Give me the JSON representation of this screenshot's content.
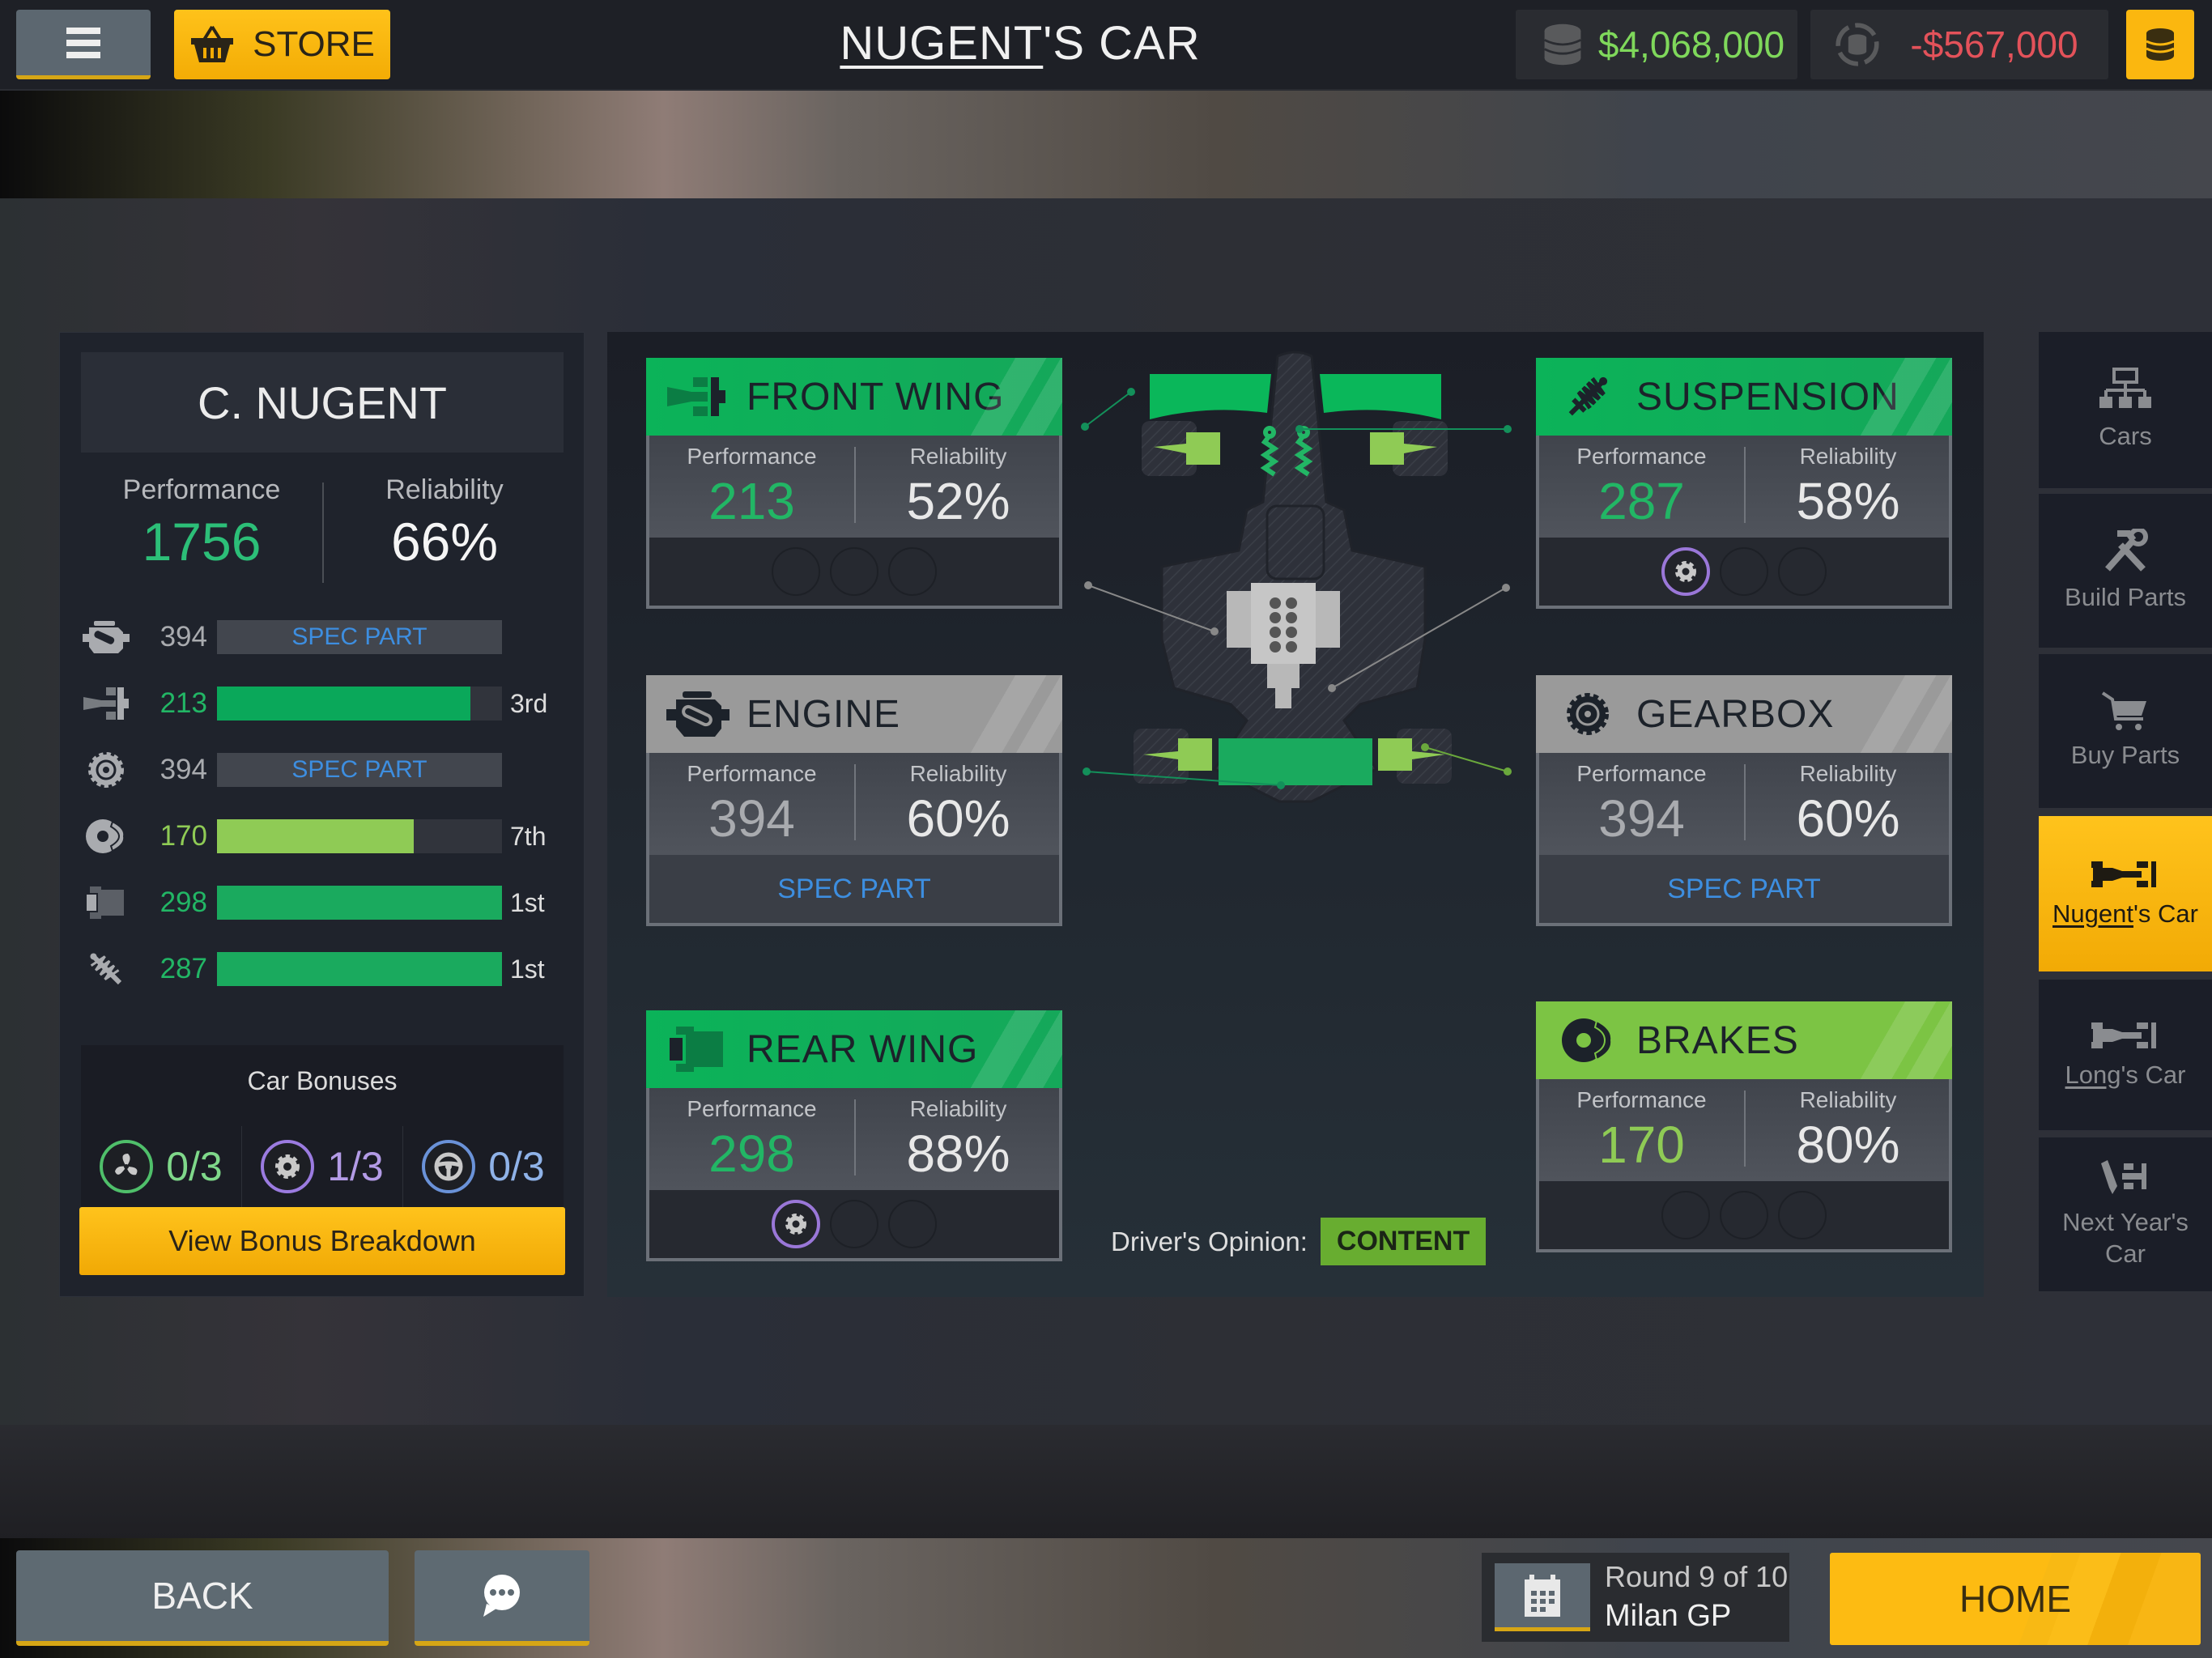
{
  "header": {
    "menu_icon": "hamburger-icon",
    "store_label": "STORE",
    "title_underlined": "NUGENT",
    "title_rest": "'S CAR",
    "balance": "$4,068,000",
    "balance_change": "-$567,000"
  },
  "driver": {
    "name": "C. NUGENT",
    "performance_label": "Performance",
    "performance": "1756",
    "reliability_label": "Reliability",
    "reliability": "66%",
    "parts": [
      {
        "part": "engine",
        "icon": "engine-icon",
        "value": "394",
        "spec": "SPEC PART",
        "rank": ""
      },
      {
        "part": "front-wing",
        "icon": "front-wing-icon",
        "value": "213",
        "fill_fraction": 0.89,
        "rank": "3rd",
        "color": "#0aa85a"
      },
      {
        "part": "gearbox",
        "icon": "gearbox-icon",
        "value": "394",
        "spec": "SPEC PART",
        "rank": ""
      },
      {
        "part": "brakes",
        "icon": "brakes-icon",
        "value": "170",
        "fill_fraction": 0.69,
        "rank": "7th",
        "color": "#8fcb55"
      },
      {
        "part": "rear-wing",
        "icon": "rear-wing-icon",
        "value": "298",
        "fill_fraction": 1.0,
        "rank": "1st",
        "color": "#1aaa5e"
      },
      {
        "part": "suspension",
        "icon": "suspension-icon",
        "value": "287",
        "fill_fraction": 1.0,
        "rank": "1st",
        "color": "#1aaa5e"
      }
    ]
  },
  "bonuses": {
    "title": "Car Bonuses",
    "items": [
      {
        "icon": "fan-icon",
        "value": "0/3",
        "color": "#4fbf6a"
      },
      {
        "icon": "gear-icon",
        "value": "1/3",
        "color": "#9b7be0"
      },
      {
        "icon": "steering-wheel-icon",
        "value": "0/3",
        "color": "#6a92d8"
      }
    ],
    "button_label": "View Bonus Breakdown"
  },
  "parts": {
    "perf_label": "Performance",
    "rel_label": "Reliability",
    "front_wing": {
      "title": "FRONT WING",
      "performance": "213",
      "reliability": "52%",
      "bonus_slots": 0
    },
    "engine": {
      "title": "ENGINE",
      "performance": "394",
      "reliability": "60%",
      "footer": "SPEC PART"
    },
    "rear_wing": {
      "title": "REAR WING",
      "performance": "298",
      "reliability": "88%",
      "bonus_slots": 1
    },
    "suspension": {
      "title": "SUSPENSION",
      "performance": "287",
      "reliability": "58%",
      "bonus_slots": 1
    },
    "gearbox": {
      "title": "GEARBOX",
      "performance": "394",
      "reliability": "60%",
      "footer": "SPEC PART"
    },
    "brakes": {
      "title": "BRAKES",
      "performance": "170",
      "reliability": "80%",
      "bonus_slots": 0
    }
  },
  "opinion": {
    "label": "Driver's Opinion:",
    "value": "CONTENT"
  },
  "nav": [
    {
      "label": "Cars",
      "icon": "hierarchy-icon"
    },
    {
      "label": "Build Parts",
      "icon": "tools-icon"
    },
    {
      "label": "Buy Parts",
      "icon": "cart-icon"
    },
    {
      "label_underlined": "Nugent",
      "label_rest": "'s Car",
      "icon": "car-icon",
      "active": true
    },
    {
      "label_underlined": "Long",
      "label_rest": "'s Car",
      "icon": "car-icon"
    },
    {
      "label": "Next Year's Car",
      "icon": "car-design-icon"
    }
  ],
  "footer": {
    "back_label": "BACK",
    "chat_icon": "chat-icon",
    "round": "Round 9 of 10",
    "race": "Milan GP",
    "home_label": "HOME"
  },
  "colors": {
    "accent_gold": "#fbb70f",
    "perf_green": "#22b665",
    "perf_lightgreen": "#8fcb55",
    "spec_blue": "#3d8ee0",
    "money_green": "#7fd85b",
    "money_red": "#e3525a",
    "perf_gray": "#a9abaf"
  }
}
